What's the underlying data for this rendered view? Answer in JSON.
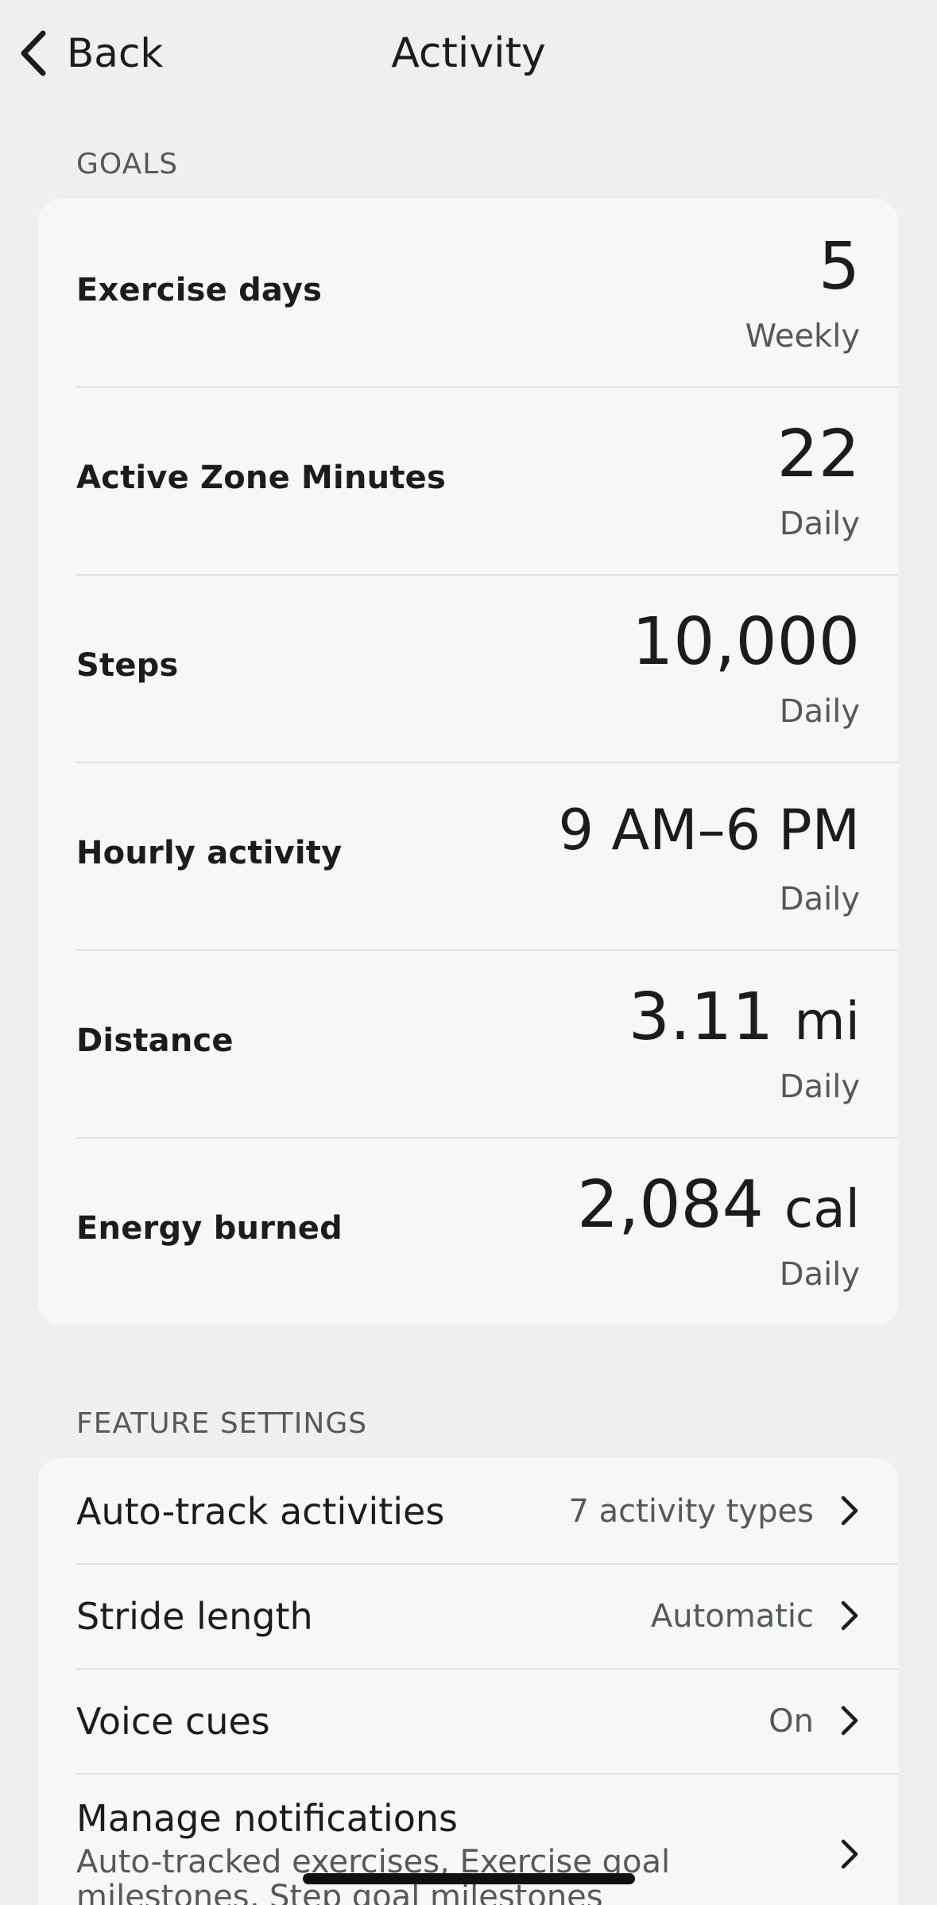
{
  "header": {
    "back_label": "Back",
    "title": "Activity"
  },
  "goals": {
    "section_label": "GOALS",
    "items": [
      {
        "name": "Exercise days",
        "value": "5",
        "unit": "",
        "period": "Weekly"
      },
      {
        "name": "Active Zone Minutes",
        "value": "22",
        "unit": "",
        "period": "Daily"
      },
      {
        "name": "Steps",
        "value": "10,000",
        "unit": "",
        "period": "Daily"
      },
      {
        "name": "Hourly activity",
        "value": "9 AM–6 PM",
        "unit": "",
        "period": "Daily"
      },
      {
        "name": "Distance",
        "value": "3.11",
        "unit": "mi",
        "period": "Daily"
      },
      {
        "name": "Energy burned",
        "value": "2,084",
        "unit": "cal",
        "period": "Daily"
      }
    ]
  },
  "feature_settings": {
    "section_label": "FEATURE SETTINGS",
    "items": [
      {
        "label": "Auto-track activities",
        "value": "7 activity types"
      },
      {
        "label": "Stride length",
        "value": "Automatic"
      },
      {
        "label": "Voice cues",
        "value": "On"
      },
      {
        "label": "Manage notifications",
        "subtext": "Auto-tracked exercises, Exercise goal milestones, Step goal milestones"
      }
    ]
  },
  "icons": {
    "back": "chevron-left-icon",
    "row": "chevron-right-icon"
  },
  "colors": {
    "background": "#eef0ee",
    "card": "#f6f8f6",
    "primary_text": "#1c1c1c",
    "secondary_text": "#555a58",
    "divider": "#dfe1df"
  }
}
